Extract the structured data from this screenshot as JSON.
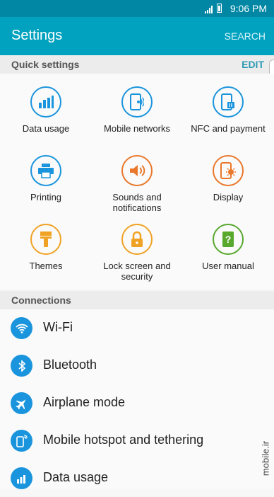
{
  "status_bar": {
    "time": "9:06 PM",
    "signal_icon": "signal-icon",
    "battery_icon": "battery-icon"
  },
  "app_bar": {
    "title": "Settings",
    "search_label": "SEARCH"
  },
  "quick_settings": {
    "header": "Quick settings",
    "edit_label": "EDIT",
    "tiles": [
      {
        "label": "Data usage",
        "icon": "bar-chart-icon",
        "color": "#1a95dd"
      },
      {
        "label": "Mobile networks",
        "icon": "mobile-network-icon",
        "color": "#1a95dd"
      },
      {
        "label": "NFC and payment",
        "icon": "nfc-payment-icon",
        "color": "#1a95dd"
      },
      {
        "label": "Printing",
        "icon": "printer-icon",
        "color": "#1a95dd"
      },
      {
        "label": "Sounds and\nnotifications",
        "icon": "speaker-icon",
        "color": "#e9782c"
      },
      {
        "label": "Display",
        "icon": "display-icon",
        "color": "#e9782c"
      },
      {
        "label": "Themes",
        "icon": "paintbrush-icon",
        "color": "#f0a224"
      },
      {
        "label": "Lock screen and\nsecurity",
        "icon": "lock-icon",
        "color": "#f0a224"
      },
      {
        "label": "User manual",
        "icon": "help-book-icon",
        "color": "#58a82e"
      }
    ]
  },
  "connections": {
    "header": "Connections",
    "items": [
      {
        "label": "Wi-Fi",
        "icon": "wifi-icon"
      },
      {
        "label": "Bluetooth",
        "icon": "bluetooth-icon"
      },
      {
        "label": "Airplane mode",
        "icon": "airplane-icon"
      },
      {
        "label": "Mobile hotspot and tethering",
        "icon": "hotspot-icon"
      },
      {
        "label": "Data usage",
        "icon": "bar-chart-icon"
      }
    ]
  },
  "watermark": "mobile.ir",
  "colors": {
    "status_bar": "#0187a3",
    "app_bar": "#01a2bf",
    "accent": "#2d9ab2",
    "blue": "#1a95dd",
    "orange": "#e9782c",
    "yellow": "#f0a224",
    "green": "#58a82e"
  }
}
